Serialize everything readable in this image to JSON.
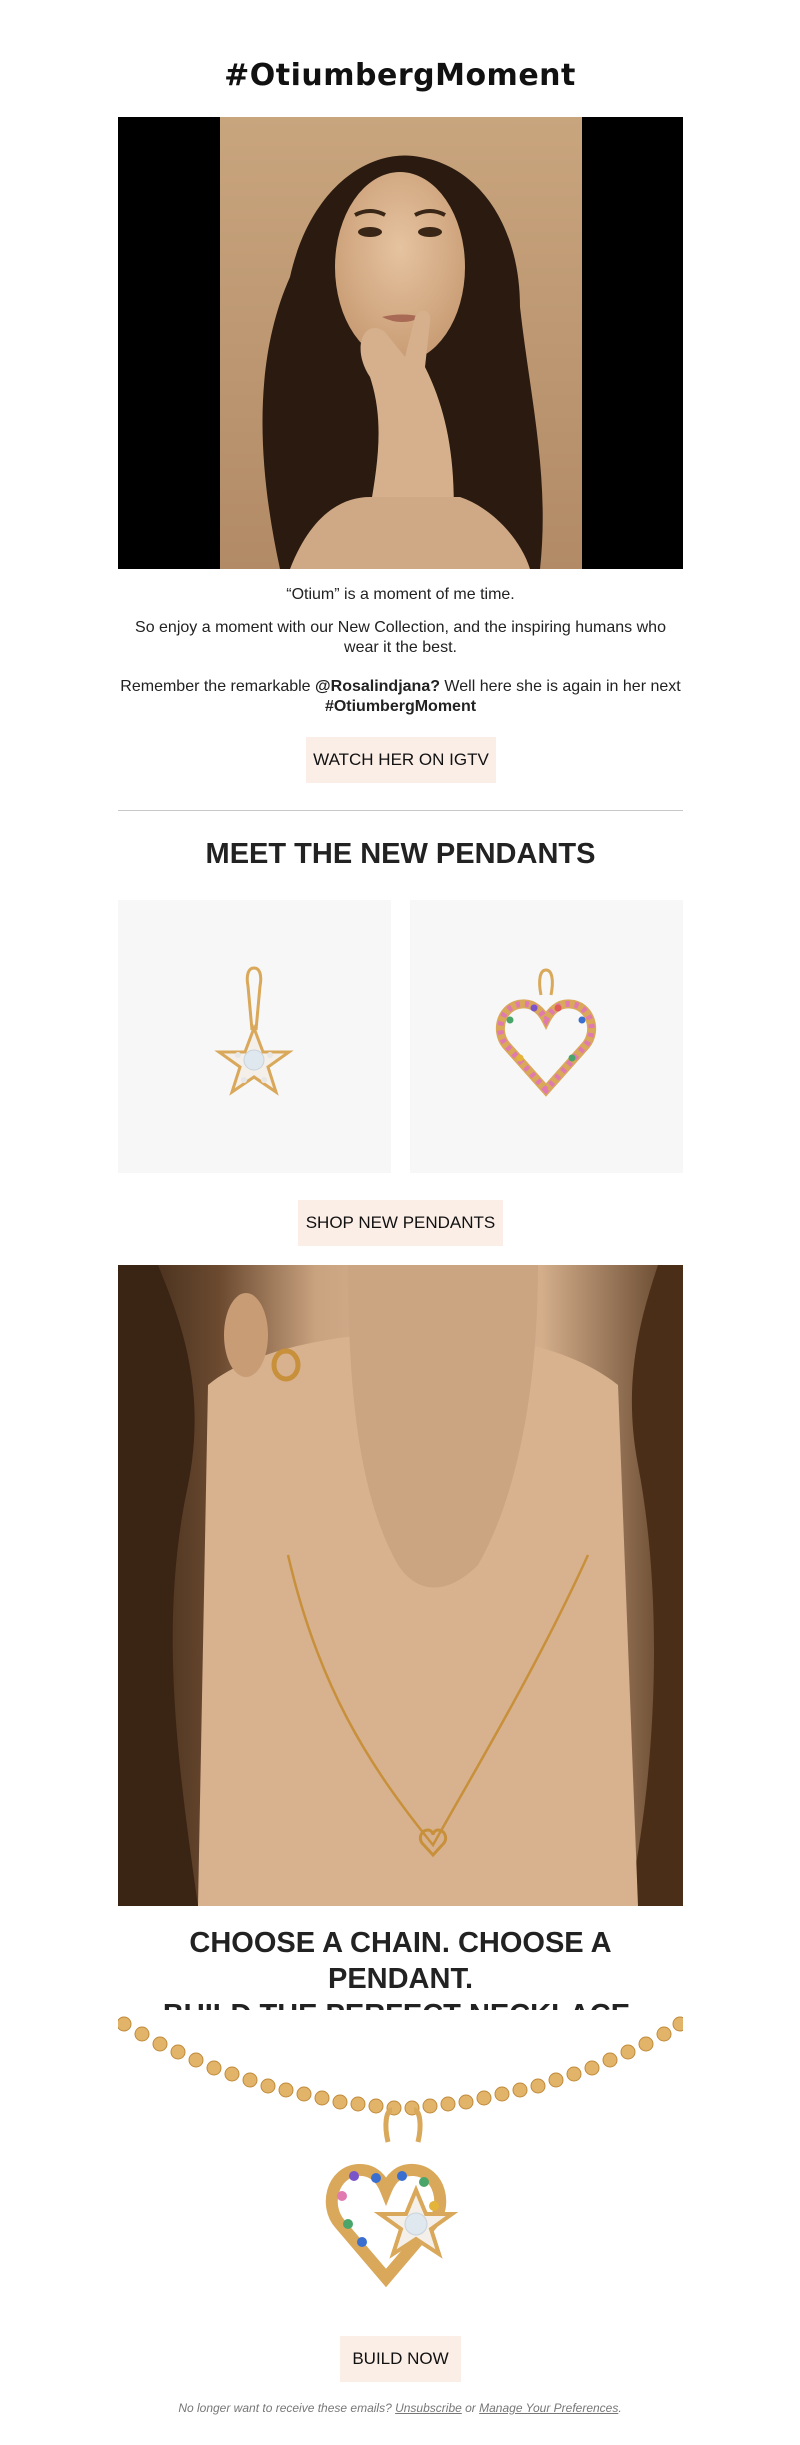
{
  "header": {
    "title": "#OtiumbergMoment"
  },
  "intro": {
    "line1": "“Otium” is a moment of me time.",
    "line2": "So enjoy a moment with our New Collection, and the inspiring humans who wear it the best.",
    "line3_prefix": "Remember the remarkable ",
    "line3_handle": "@Rosalindjana?",
    "line3_suffix": " Well here she is again in her next ",
    "line3_tag": "#OtiumbergMoment"
  },
  "buttons": {
    "igtv": "WATCH HER ON IGTV",
    "shop": "SHOP NEW PENDANTS",
    "build": "BUILD NOW"
  },
  "pendants": {
    "heading": "MEET THE NEW PENDANTS",
    "items": [
      {
        "name": "star-pendant",
        "icon": "star-pendant-icon"
      },
      {
        "name": "heart-pendant",
        "icon": "rainbow-heart-pendant-icon"
      }
    ]
  },
  "build": {
    "heading_line1": "CHOOSE A CHAIN. CHOOSE A PENDANT.",
    "heading_line2": "BUILD THE PERFECT NECKLACE."
  },
  "footer": {
    "prefix": "No longer want to receive these emails? ",
    "unsubscribe": "Unsubscribe",
    "or": " or ",
    "manage": "Manage Your Preferences",
    "suffix": "."
  },
  "colors": {
    "button_bg": "#fbeee7",
    "text": "#222222",
    "gold": "#d9a85a",
    "divider": "#c8c8c8"
  }
}
